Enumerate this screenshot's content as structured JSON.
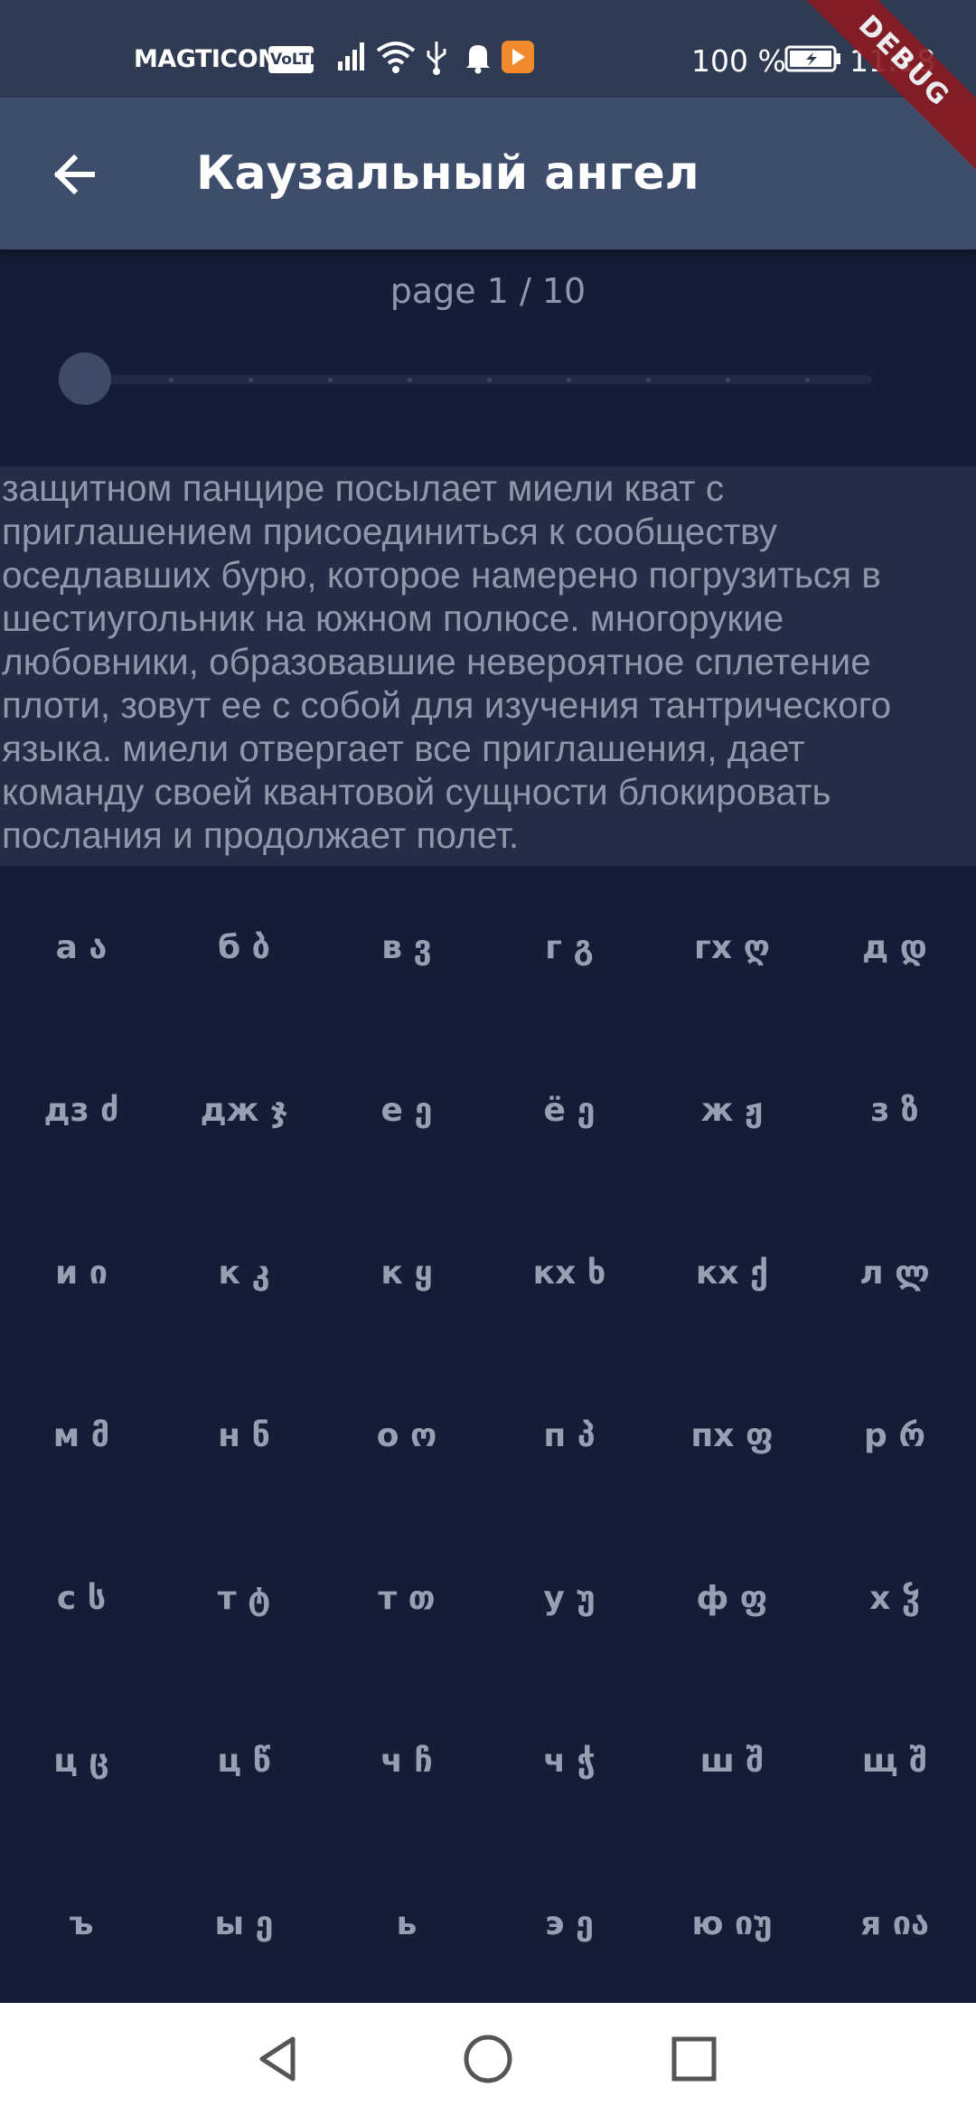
{
  "status_bar": {
    "carrier": "MAGTICOM",
    "volte_badge": "VoLTE",
    "battery_percent": "100 %",
    "time": "11:18",
    "icons": [
      "signal-icon",
      "wifi-icon",
      "usb-icon",
      "notification-bell-icon",
      "app-notification-icon",
      "battery-charging-icon"
    ]
  },
  "debug_banner": "DEBUG",
  "app_bar": {
    "back_icon": "arrow-back-icon",
    "title": "Каузальный ангел"
  },
  "pager": {
    "label": "page 1 / 10",
    "current": 1,
    "total": 10
  },
  "content": {
    "text": "защитном панцире посылает миели кват с\nприглашением присоединиться к сообществу\nоседлавших бурю, которое намерено погрузиться в\nшестиугольник на южном полюсе. многорукие\nлюбовники, образовавшие невероятное сплетение\nплоти, зовут ее с собой для изучения тантрического\nязыка. миели отвергает все приглашения, дает\nкоманду своей квантовой сущности блокировать\nпослания и продолжает полет."
  },
  "keyboard": {
    "keys": [
      "а ა",
      "б ბ",
      "в ვ",
      "г გ",
      "гх ღ",
      "д დ",
      "дз ძ",
      "дж ჯ",
      "е ე",
      "ё ე",
      "ж ჟ",
      "з ზ",
      "и ი",
      "к კ",
      "к ყ",
      "кх ხ",
      "кх ქ",
      "л ლ",
      "м მ",
      "н ნ",
      "о ო",
      "п პ",
      "пх ფ",
      "р რ",
      "с ს",
      "т ტ",
      "т თ",
      "у უ",
      "ф ფ",
      "х ჴ",
      "ц ც",
      "ц წ",
      "ч ჩ",
      "ч ჭ",
      "ш შ",
      "щ შ",
      "ъ",
      "ы ე",
      "ь",
      "э ე",
      "ю იუ",
      "я ია"
    ]
  },
  "nav_bar": {
    "icons": [
      "nav-back-icon",
      "nav-home-icon",
      "nav-recents-icon"
    ]
  },
  "colors": {
    "background": "#141d36",
    "app_bar": "#3e4d6b",
    "status_bar": "#2f3a53",
    "text_panel": "#232d45",
    "text": "#8f98ab",
    "key_text": "#97a0b2"
  }
}
